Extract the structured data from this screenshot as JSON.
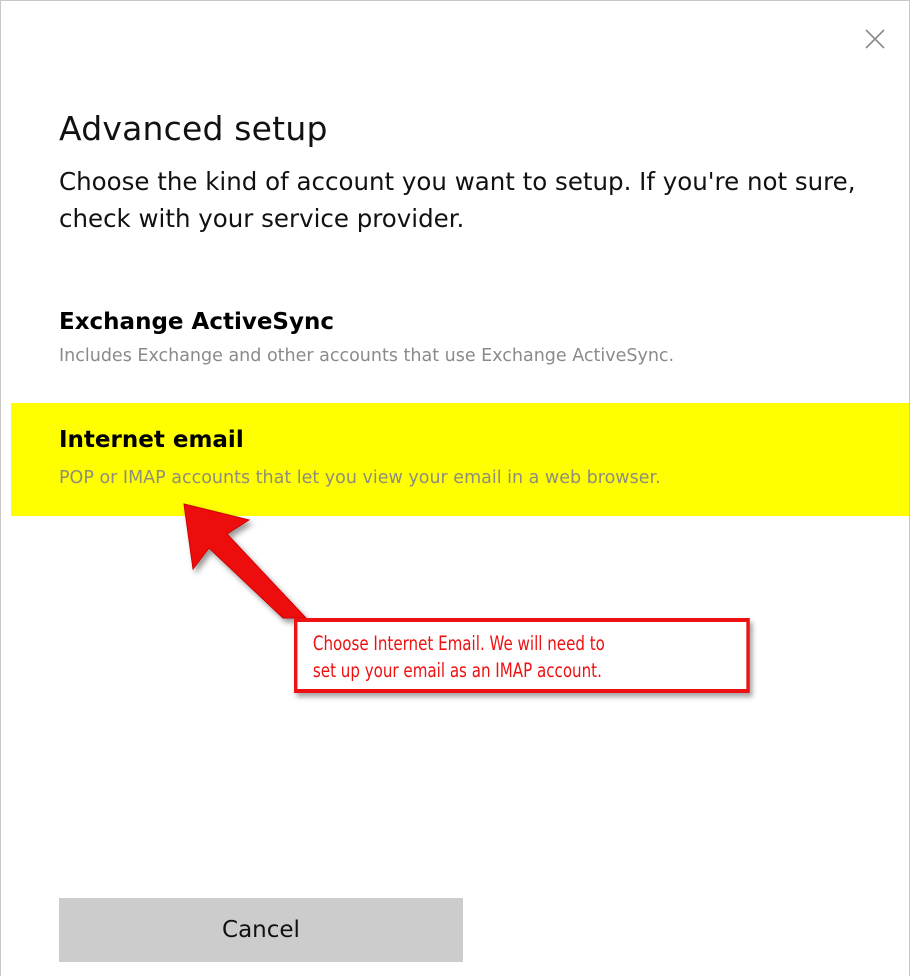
{
  "dialog": {
    "title": "Advanced setup",
    "subtitle": "Choose the kind of account you want to setup. If you're not sure, check with your service provider.",
    "close_icon": "close-icon"
  },
  "options": [
    {
      "title": "Exchange ActiveSync",
      "description": "Includes Exchange and other accounts that use Exchange ActiveSync.",
      "highlighted": false
    },
    {
      "title": "Internet email",
      "description": "POP or IMAP accounts that let you view your email in a web browser.",
      "highlighted": true
    }
  ],
  "annotation": {
    "lines": [
      "Choose Internet Email. We will need to",
      "set up your email as an IMAP account."
    ],
    "color": "#ee1111",
    "highlight_color": "#ffff00"
  },
  "footer": {
    "cancel_label": "Cancel"
  }
}
